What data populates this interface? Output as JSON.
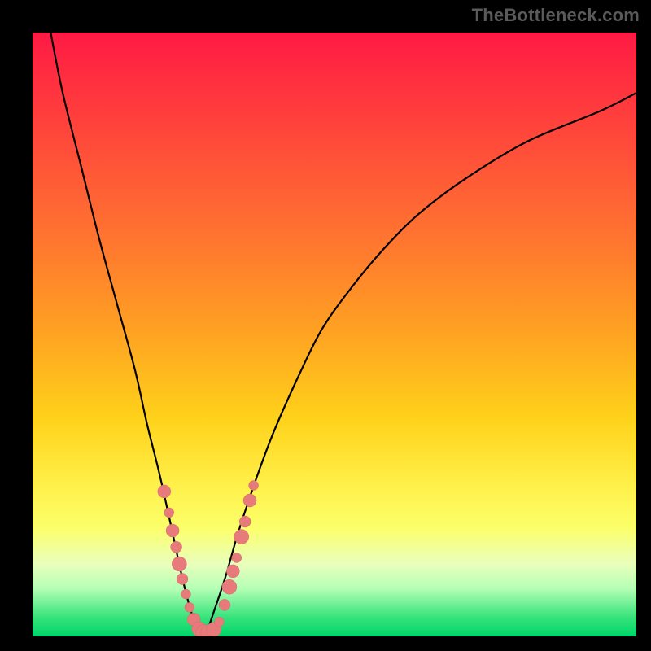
{
  "watermark": "TheBottleneck.com",
  "chart_data": {
    "type": "line",
    "title": "",
    "xlabel": "",
    "ylabel": "",
    "xlim": [
      0,
      100
    ],
    "ylim": [
      0,
      100
    ],
    "grid": false,
    "series": [
      {
        "name": "bottleneck-curve",
        "x": [
          3,
          5,
          8,
          11,
          14,
          17,
          19,
          21,
          23,
          24.5,
          26,
          27.2,
          28.2,
          29,
          30,
          32,
          34,
          37,
          40,
          44,
          48,
          53,
          58,
          64,
          72,
          82,
          94,
          100
        ],
        "y": [
          100,
          90,
          78,
          66,
          55,
          44,
          35,
          27,
          18,
          11,
          5,
          1.5,
          0,
          1.2,
          4,
          10,
          17,
          26,
          34,
          43,
          51,
          58,
          64,
          70,
          76,
          82,
          87,
          90
        ]
      }
    ],
    "annotations": {
      "data_points_coral": {
        "description": "clustered sample markers near the trough of the curve",
        "points": [
          {
            "x": 21.8,
            "y": 24.0,
            "r": 8
          },
          {
            "x": 22.6,
            "y": 20.5,
            "r": 6
          },
          {
            "x": 23.2,
            "y": 17.5,
            "r": 8
          },
          {
            "x": 23.8,
            "y": 14.8,
            "r": 7
          },
          {
            "x": 24.3,
            "y": 12.0,
            "r": 9
          },
          {
            "x": 24.8,
            "y": 9.5,
            "r": 7
          },
          {
            "x": 25.4,
            "y": 7.0,
            "r": 6
          },
          {
            "x": 26.0,
            "y": 4.8,
            "r": 6
          },
          {
            "x": 26.7,
            "y": 2.8,
            "r": 8
          },
          {
            "x": 27.6,
            "y": 1.2,
            "r": 9
          },
          {
            "x": 28.4,
            "y": 0.6,
            "r": 10
          },
          {
            "x": 29.2,
            "y": 0.6,
            "r": 10
          },
          {
            "x": 30.0,
            "y": 1.1,
            "r": 9
          },
          {
            "x": 30.9,
            "y": 2.4,
            "r": 6
          },
          {
            "x": 31.8,
            "y": 5.2,
            "r": 7
          },
          {
            "x": 32.6,
            "y": 8.2,
            "r": 9
          },
          {
            "x": 33.2,
            "y": 10.8,
            "r": 8
          },
          {
            "x": 33.8,
            "y": 13.0,
            "r": 6
          },
          {
            "x": 34.6,
            "y": 16.5,
            "r": 9
          },
          {
            "x": 35.2,
            "y": 19.0,
            "r": 7
          },
          {
            "x": 36.0,
            "y": 22.5,
            "r": 8
          },
          {
            "x": 36.6,
            "y": 25.0,
            "r": 6
          }
        ]
      }
    }
  }
}
